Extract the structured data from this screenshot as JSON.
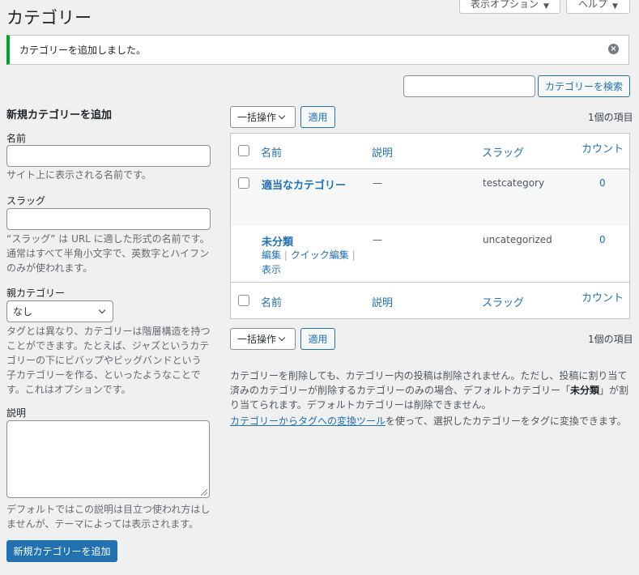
{
  "page": {
    "title": "カテゴリー",
    "screen_options_label": "表示オプション",
    "help_label": "ヘルプ",
    "notice": "カテゴリーを追加しました。"
  },
  "search": {
    "value": "",
    "button_label": "カテゴリーを検索"
  },
  "form": {
    "heading": "新規カテゴリーを追加",
    "name_label": "名前",
    "name_value": "",
    "name_desc": "サイト上に表示される名前です。",
    "slug_label": "スラッグ",
    "slug_value": "",
    "slug_desc": "“スラッグ” は URL に適した形式の名前です。通常はすべて半角小文字で、英数字とハイフンのみが使われます。",
    "parent_label": "親カテゴリー",
    "parent_selected": "なし",
    "parent_desc": "タグとは異なり、カテゴリーは階層構造を持つことができます。たとえば、ジャズというカテゴリーの下にビバップやビッグバンドという子カテゴリーを作る、といったようなことです。これはオプションです。",
    "description_label": "説明",
    "description_value": "",
    "description_desc": "デフォルトではこの説明は目立つ使われ方はしませんが、テーマによっては表示されます。",
    "submit_label": "新規カテゴリーを追加"
  },
  "bulk": {
    "action_label": "一括操作",
    "apply_label": "適用",
    "item_count": "1個の項目"
  },
  "table": {
    "columns": {
      "name": "名前",
      "description": "説明",
      "slug": "スラッグ",
      "count": "カウント"
    },
    "rows": [
      {
        "name": "適当なカテゴリー",
        "description": "—",
        "slug": "testcategory",
        "count": "0"
      },
      {
        "name": "未分類",
        "description": "—",
        "slug": "uncategorized",
        "count": "0",
        "actions": {
          "edit": "編集",
          "quick_edit": "クイック編集",
          "view": "表示",
          "separator": "|"
        }
      }
    ]
  },
  "footer": {
    "note_part1": "カテゴリーを削除しても、カテゴリー内の投稿は削除されません。ただし、投稿に割り当て済みのカテゴリーが削除するカテゴリーのみの場合、デフォルトカテゴリー「",
    "note_bold": "未分類",
    "note_part2": "」が割り当てられます。デフォルトカテゴリーは削除できません。",
    "converter_link": "カテゴリーからタグへの変換ツール",
    "converter_text": "を使って、選択したカテゴリーをタグに変換できます。"
  },
  "colors": {
    "accent": "#2271b1",
    "success": "#00a32a",
    "background": "#f0f0f1"
  }
}
